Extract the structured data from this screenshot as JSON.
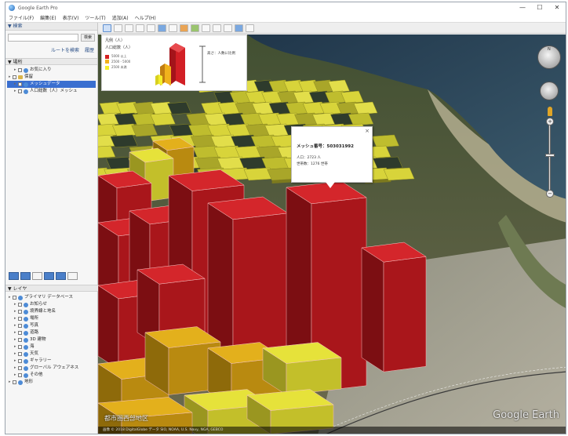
{
  "window": {
    "title": "Google Earth Pro",
    "controls": [
      "—",
      "☐",
      "✕"
    ]
  },
  "menu": [
    "ファイル(F)",
    "編集(E)",
    "表示(V)",
    "ツール(T)",
    "追加(A)",
    "ヘルプ(H)"
  ],
  "search": {
    "header": "▼ 検索",
    "button": "検索",
    "route_link": "ルートを検索",
    "history_link": "履歴"
  },
  "places": {
    "header": "▼ 場所",
    "items": [
      {
        "label": "お気に入り",
        "indent": 1,
        "type": "globe",
        "selected": false
      },
      {
        "label": "保留",
        "indent": 0,
        "type": "folder",
        "selected": false
      },
      {
        "label": "メッシュデータ",
        "indent": 1,
        "type": "globe",
        "selected": true
      },
      {
        "label": "人口総数（人）メッシュ",
        "indent": 1,
        "type": "globe",
        "selected": false
      }
    ]
  },
  "layers": {
    "header": "▼ レイヤ",
    "items": [
      {
        "label": "プライマリ データベース",
        "indent": 0
      },
      {
        "label": "お知らせ",
        "indent": 1
      },
      {
        "label": "境界線と地名",
        "indent": 1
      },
      {
        "label": "場所",
        "indent": 1
      },
      {
        "label": "写真",
        "indent": 1
      },
      {
        "label": "道路",
        "indent": 1
      },
      {
        "label": "3D 建物",
        "indent": 1
      },
      {
        "label": "海",
        "indent": 1
      },
      {
        "label": "天気",
        "indent": 1
      },
      {
        "label": "ギャラリー",
        "indent": 1
      },
      {
        "label": "グローバル アウェアネス",
        "indent": 1
      },
      {
        "label": "その他",
        "indent": 1
      },
      {
        "label": "地形",
        "indent": 0
      }
    ]
  },
  "legend": {
    "title": "凡例（人）",
    "subtitle": "人口総数（人）",
    "entries": [
      {
        "label": "5000 以上",
        "color": "#d42020"
      },
      {
        "label": "2500 - 5000",
        "color": "#f2b21c"
      },
      {
        "label": "2500 未満",
        "color": "#f4ef2a"
      }
    ],
    "height_note": "高さ：人数に比例"
  },
  "balloon": {
    "close": "×",
    "title": "メッシュ番号：503031992",
    "lines": [
      "人口：2723 人",
      "世帯数：1276 世帯"
    ]
  },
  "navigation": {
    "north_label": "N",
    "zoom_in": "+",
    "zoom_out": "−"
  },
  "status": {
    "overlay_text": "都市圏西部地区",
    "bar_text": "画像 © 2018 DigitalGlobe   データ SIO, NOAA, U.S. Navy, NGA, GEBCO",
    "brand": "Google Earth"
  },
  "colors": {
    "high": "#c0161c",
    "mid": "#e6b21a",
    "low": "#e8e63a",
    "selection": "#3a6fd0"
  }
}
